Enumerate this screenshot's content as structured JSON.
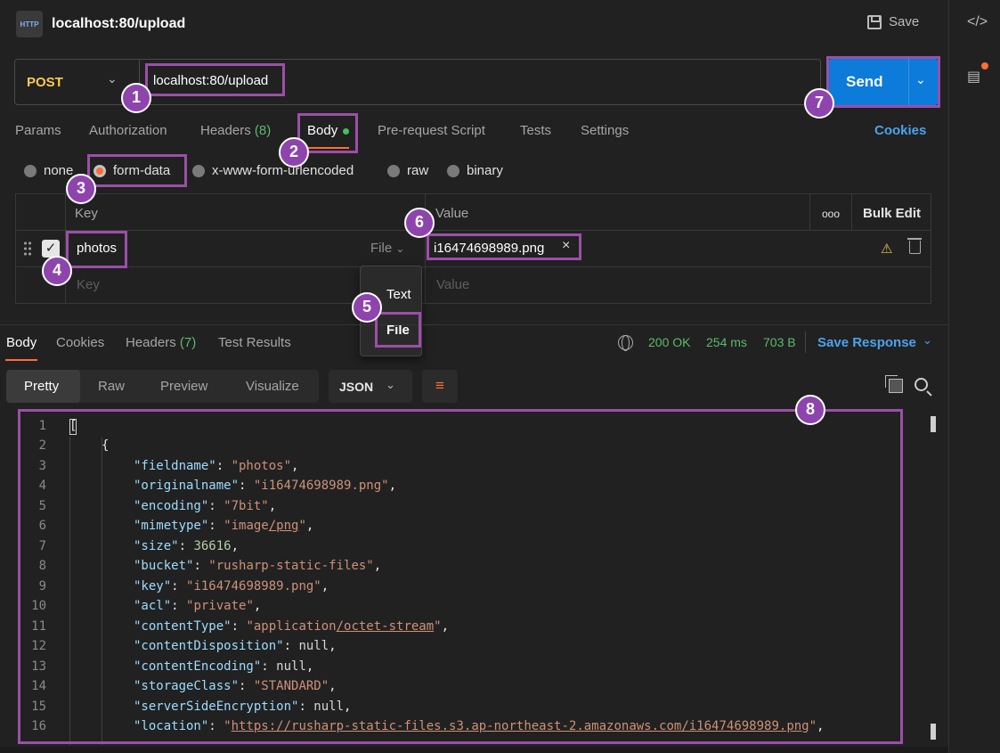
{
  "title": "localhost:80/upload",
  "logo_text": "HTTP",
  "save_label": "Save",
  "request": {
    "method": "POST",
    "url": "localhost:80/upload",
    "send_label": "Send"
  },
  "request_tabs": {
    "params": "Params",
    "authorization": "Authorization",
    "headers": "Headers",
    "headers_count": "(8)",
    "body": "Body",
    "pre_request": "Pre-request Script",
    "tests": "Tests",
    "settings": "Settings",
    "cookies": "Cookies"
  },
  "body_types": {
    "none": "none",
    "form_data": "form-data",
    "urlencoded": "x-www-form-urlencoded",
    "raw": "raw",
    "binary": "binary"
  },
  "form_table": {
    "key_header": "Key",
    "value_header": "Value",
    "more": "ooo",
    "bulk_edit": "Bulk Edit",
    "row_key": "photos",
    "row_type": "File",
    "row_value": "i16474698989.png",
    "key_placeholder": "Key",
    "value_placeholder": "Value"
  },
  "type_dropdown": {
    "text": "Text",
    "file": "File"
  },
  "response_tabs": {
    "body": "Body",
    "cookies": "Cookies",
    "headers": "Headers",
    "headers_count": "(7)",
    "test_results": "Test Results"
  },
  "response_status": {
    "status": "200 OK",
    "time": "254 ms",
    "size": "703 B",
    "save_response": "Save Response"
  },
  "format": {
    "pretty": "Pretty",
    "raw": "Raw",
    "preview": "Preview",
    "visualize": "Visualize",
    "language": "JSON"
  },
  "code": {
    "line_numbers": [
      "1",
      "2",
      "3",
      "4",
      "5",
      "6",
      "7",
      "8",
      "9",
      "10",
      "11",
      "12",
      "13",
      "14",
      "15",
      "16"
    ],
    "open_bracket": "[",
    "open_brace": "{",
    "l3k": "\"fieldname\"",
    "l3v": "\"photos\"",
    "l4k": "\"originalname\"",
    "l4v": "\"i16474698989.png\"",
    "l5k": "\"encoding\"",
    "l5v": "\"7bit\"",
    "l6k": "\"mimetype\"",
    "l6v1": "\"image",
    "l6v2": "/png",
    "l6v3": "\"",
    "l7k": "\"size\"",
    "l7v": "36616",
    "l8k": "\"bucket\"",
    "l8v": "\"rusharp-static-files\"",
    "l9k": "\"key\"",
    "l9v": "\"i16474698989.png\"",
    "l10k": "\"acl\"",
    "l10v": "\"private\"",
    "l11k": "\"contentType\"",
    "l11v1": "\"application",
    "l11v2": "/octet-stream",
    "l11v3": "\"",
    "l12k": "\"contentDisposition\"",
    "l12v": "null",
    "l13k": "\"contentEncoding\"",
    "l13v": "null",
    "l14k": "\"storageClass\"",
    "l14v": "\"STANDARD\"",
    "l15k": "\"serverSideEncryption\"",
    "l15v": "null",
    "l16k": "\"location\"",
    "l16v1": "\"",
    "l16v2": "https://rusharp-static-files.s3.ap-northeast-2.amazonaws.com/i16474698989.png",
    "l16v3": "\""
  },
  "annotations": [
    "1",
    "2",
    "3",
    "4",
    "5",
    "6",
    "7",
    "8"
  ],
  "colors": {
    "accent_orange": "#ff6c37",
    "send_blue": "#0d7bd9",
    "annotation_purple": "#9b4fa8",
    "status_green": "#5cbb6a"
  }
}
